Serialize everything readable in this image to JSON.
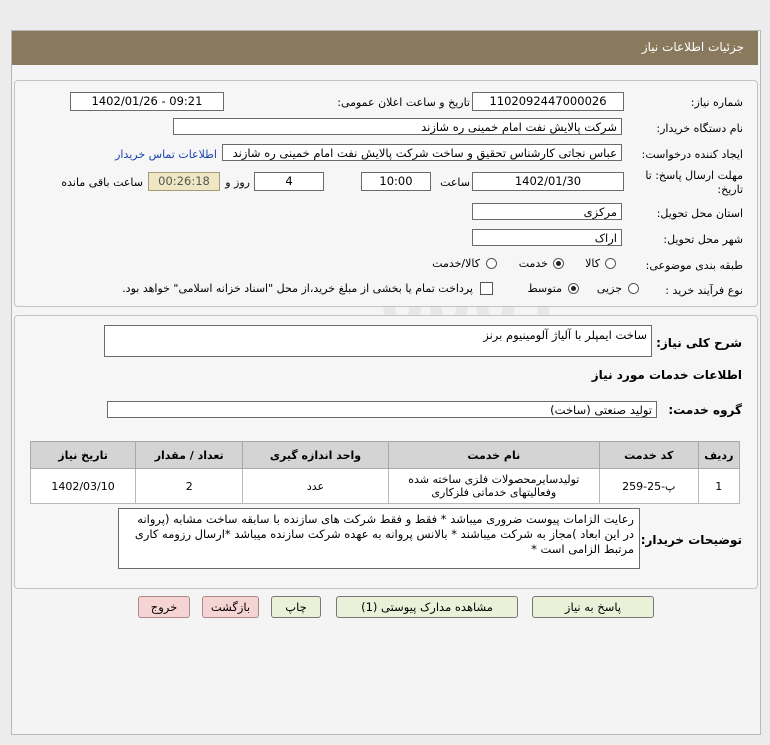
{
  "header": {
    "title": "جزئیات اطلاعات نیاز"
  },
  "fields": {
    "need_number_label": "شماره نیاز:",
    "need_number": "1102092447000026",
    "announce_label": "تاریخ و ساعت اعلان عمومی:",
    "announce_value": "1402/01/26 - 09:21",
    "buyer_org_label": "نام دستگاه خریدار:",
    "buyer_org": "شرکت پالایش نفت امام خمینی  ره  شازند",
    "requester_label": "ایجاد کننده درخواست:",
    "requester": "عباس نجاتی کارشناس تحقیق و ساخت شرکت پالایش نفت امام خمینی  ره  شازند",
    "contact_link": "اطلاعات تماس خریدار",
    "deadline_label_1": "مهلت ارسال پاسخ: تا",
    "deadline_label_2": "تاریخ:",
    "deadline_date": "1402/01/30",
    "time_label": "ساعت",
    "deadline_time": "10:00",
    "days_value": "4",
    "days_label": "روز و",
    "remaining_time": "00:26:18",
    "remaining_label": "ساعت باقی مانده",
    "province_label": "استان محل تحویل:",
    "province": "مرکزی",
    "city_label": "شهر محل تحویل:",
    "city": "اراک",
    "category_label": "طبقه بندی موضوعی:",
    "category_options": [
      "کالا",
      "خدمت",
      "کالا/خدمت"
    ],
    "category_selected": "خدمت",
    "purchase_type_label": "نوع فرآیند خرید :",
    "purchase_options": [
      "جزیی",
      "متوسط"
    ],
    "purchase_selected": "متوسط",
    "payment_note": "پرداخت تمام یا بخشی از مبلغ خرید،از محل \"اسناد خزانه اسلامی\" خواهد بود."
  },
  "summary": {
    "label": "شرح کلی نیاز:",
    "value": "ساخت ایمپلر با آلیاژ آلومینیوم برنز"
  },
  "services_section": {
    "title": "اطلاعات خدمات مورد نیاز",
    "group_label": "گروه خدمت:",
    "group_value": "تولید صنعتی (ساخت)"
  },
  "table": {
    "headers": [
      "ردیف",
      "کد خدمت",
      "نام خدمت",
      "واحد اندازه گیری",
      "تعداد / مقدار",
      "تاریخ نیاز"
    ],
    "rows": [
      [
        "1",
        "پ-25-259",
        "تولیدسایرمحصولات فلزی ساخته شده وفعالیتهای خدماتی فلزکاری",
        "عدد",
        "2",
        "1402/03/10"
      ]
    ]
  },
  "buyer_notes": {
    "label": "توضیحات خریدار:",
    "text": "رعایت الزامات پیوست ضروری میباشد * فقط و فقط شرکت های سازنده با سابقه ساخت مشابه  (پروانه در این ابعاد )مجاز به شرکت میباشند * بالانس پروانه به عهده شرکت سازنده میباشد *ارسال رزومه کاری مرتبط الزامی است *"
  },
  "buttons": {
    "reply": "پاسخ به نیاز",
    "view_docs": "مشاهده مدارک پیوستی (1)",
    "print": "چاپ",
    "back": "بازگشت",
    "exit": "خروج"
  },
  "colors": {
    "header_bg": "#8a7a5d",
    "button_bg": "#e9f2d9",
    "exit_button_bg": "#f6d4d4",
    "link": "#1a3fb0",
    "timer_bg": "#efe6c4"
  }
}
